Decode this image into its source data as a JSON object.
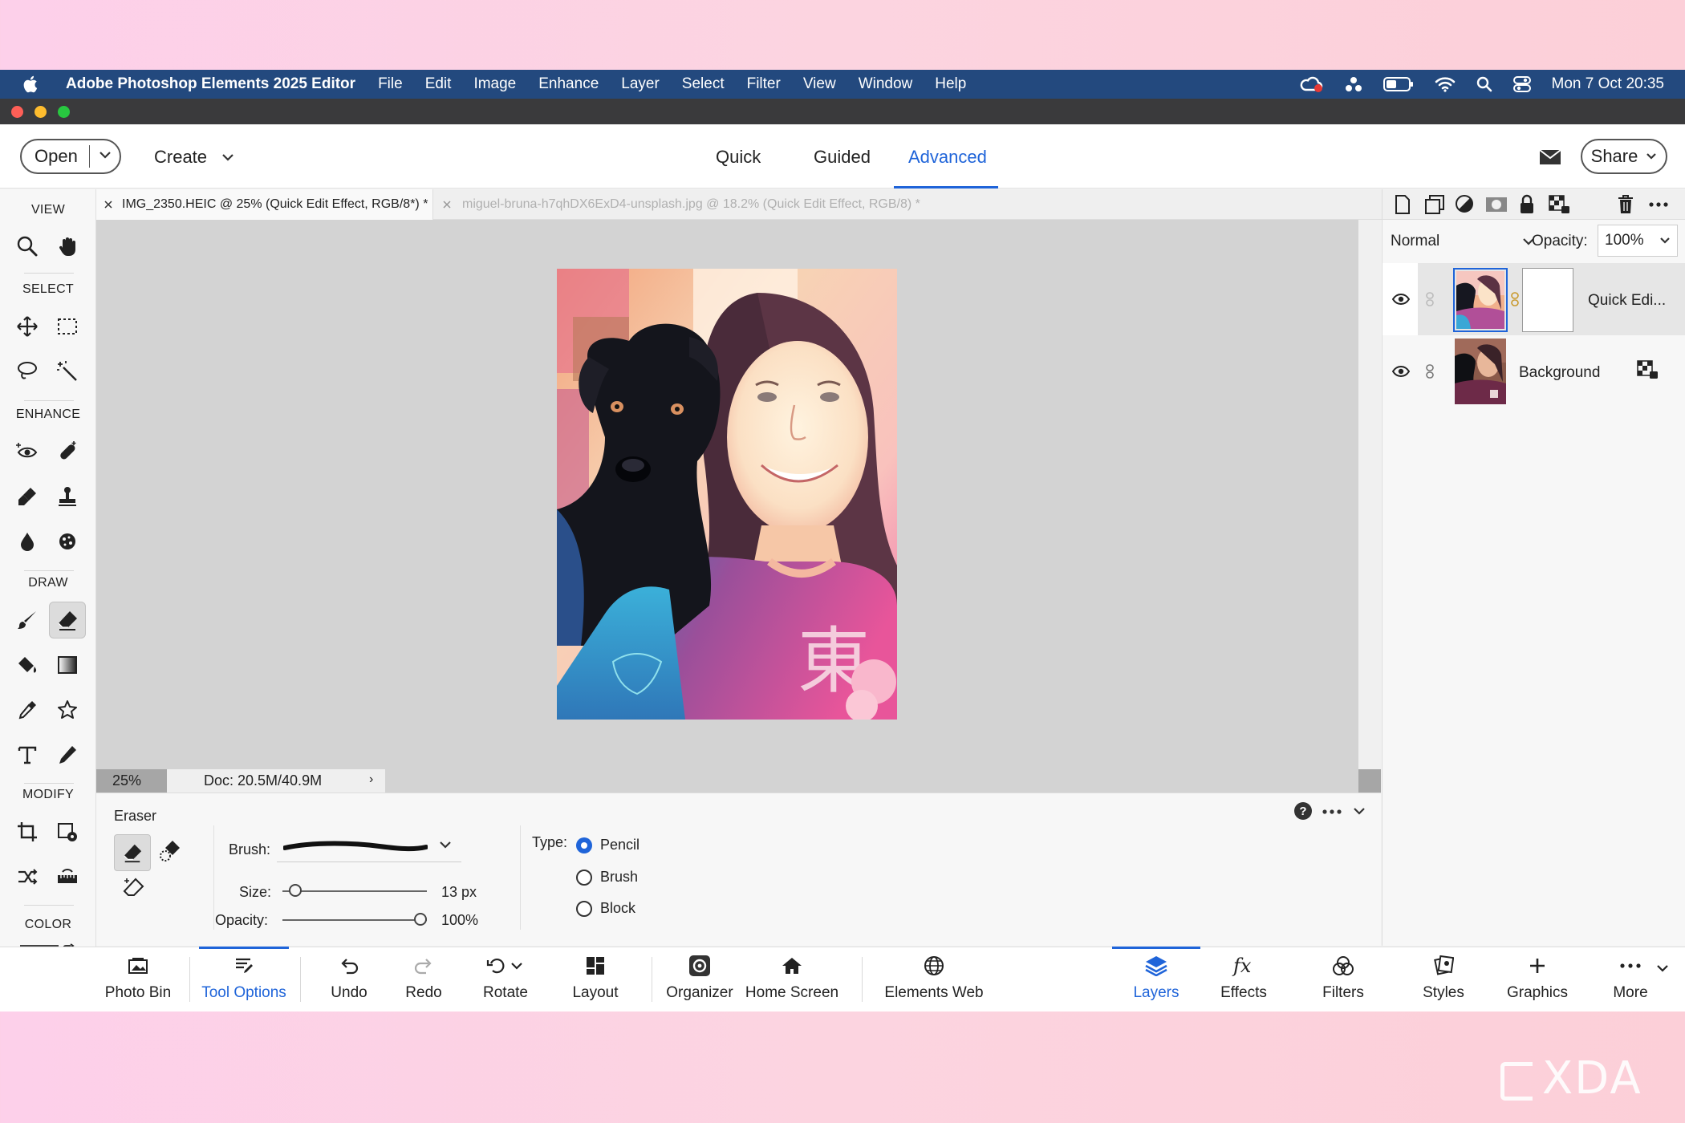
{
  "menubar": {
    "app_name": "Adobe Photoshop Elements 2025 Editor",
    "items": [
      "File",
      "Edit",
      "Image",
      "Enhance",
      "Layer",
      "Select",
      "Filter",
      "View",
      "Window",
      "Help"
    ],
    "clock": "Mon 7 Oct  20:35"
  },
  "topbar": {
    "open_label": "Open",
    "create_label": "Create",
    "modes": [
      "Quick",
      "Guided",
      "Advanced"
    ],
    "active_mode": "Advanced",
    "share_label": "Share"
  },
  "tabs": [
    {
      "label": "IMG_2350.HEIC @ 25% (Quick Edit Effect, RGB/8*) *",
      "active": true
    },
    {
      "label": "miguel-bruna-h7qhDX6ExD4-unsplash.jpg @ 18.2% (Quick Edit Effect, RGB/8) *",
      "active": false
    }
  ],
  "tools": {
    "sections": {
      "view": "VIEW",
      "select": "SELECT",
      "enhance": "ENHANCE",
      "draw": "DRAW",
      "modify": "MODIFY",
      "color": "COLOR"
    }
  },
  "status": {
    "zoom": "25%",
    "doc": "Doc: 20.5M/40.9M"
  },
  "options": {
    "tool_name": "Eraser",
    "brush_label": "Brush:",
    "size_label": "Size:",
    "size_value": "13 px",
    "size_fraction": 0.05,
    "opacity_label": "Opacity:",
    "opacity_value": "100%",
    "opacity_fraction": 1.0,
    "type_label": "Type:",
    "types": [
      "Pencil",
      "Brush",
      "Block"
    ],
    "selected_type": "Pencil"
  },
  "layers": {
    "blend_mode": "Normal",
    "opacity_label": "Opacity:",
    "opacity_value": "100%",
    "items": [
      {
        "name": "Quick Edi...",
        "selected": true
      },
      {
        "name": "Background",
        "selected": false
      }
    ]
  },
  "bottombar": {
    "left": [
      "Photo Bin",
      "Tool Options",
      "Undo",
      "Redo",
      "Rotate",
      "Layout",
      "Organizer",
      "Home Screen",
      "Elements Web"
    ],
    "right": [
      "Layers",
      "Effects",
      "Filters",
      "Styles",
      "Graphics",
      "More"
    ],
    "active_left": "Tool Options",
    "active_right": "Layers"
  },
  "colors": {
    "accent": "#1f64d9",
    "menubar": "#23497e",
    "foreground_swatch": "#000000",
    "background_swatch": "#ffffff"
  },
  "watermark": "XDA"
}
